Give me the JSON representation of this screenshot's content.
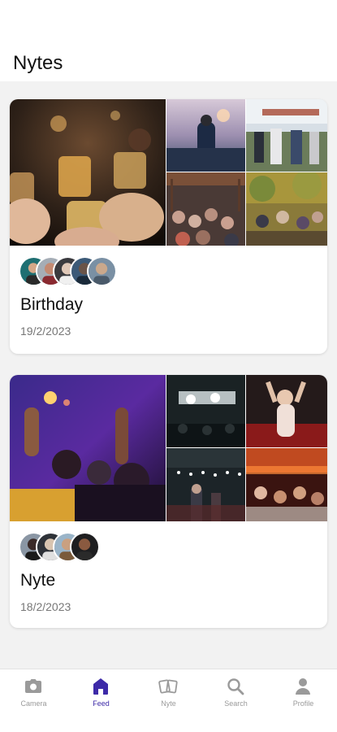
{
  "header": {
    "title": "Nytes"
  },
  "feed": {
    "cards": [
      {
        "title": "Birthday",
        "date": "19/2/2023",
        "avatar_count": 5
      },
      {
        "title": "Nyte",
        "date": "18/2/2023",
        "avatar_count": 4
      }
    ]
  },
  "tabbar": {
    "items": [
      {
        "label": "Camera",
        "icon": "camera-icon",
        "active": false
      },
      {
        "label": "Feed",
        "icon": "home-icon",
        "active": true
      },
      {
        "label": "Nyte",
        "icon": "photos-icon",
        "active": false
      },
      {
        "label": "Search",
        "icon": "search-icon",
        "active": false
      },
      {
        "label": "Profile",
        "icon": "person-icon",
        "active": false
      }
    ]
  },
  "colors": {
    "accent": "#3d2aa8",
    "inactive": "#9a9a9a",
    "background": "#f2f2f2"
  }
}
